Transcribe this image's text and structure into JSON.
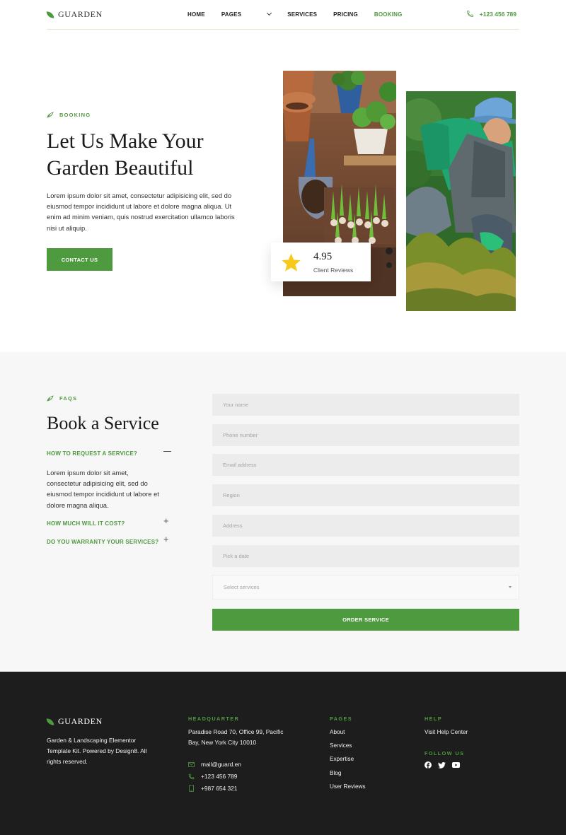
{
  "brand": {
    "name": "GUARDEN"
  },
  "nav": {
    "items": [
      {
        "label": "HOME",
        "active": false
      },
      {
        "label": "PAGES",
        "active": false,
        "has_dropdown": true
      },
      {
        "label": "SERVICES",
        "active": false
      },
      {
        "label": "PRICING",
        "active": false
      },
      {
        "label": "BOOKING",
        "active": true
      }
    ],
    "phone": "+123 456 789"
  },
  "hero": {
    "eyebrow": "BOOKING",
    "title_line1": "Let Us Make Your",
    "title_line2": "Garden Beautiful",
    "body": "Lorem ipsum dolor sit amet, consectetur adipisicing elit, sed do eiusmod tempor incididunt ut labore et dolore magna aliqua. Ut enim ad minim veniam, quis nostrud exercitation ullamco laboris nisi ut aliquip.",
    "cta_label": "CONTACT US",
    "rating": {
      "value": "4.95",
      "label": "Client Reviews",
      "icon": "star-icon"
    }
  },
  "booking": {
    "eyebrow": "FAQS",
    "title": "Book a Service",
    "faqs": [
      {
        "question": "HOW TO REQUEST A SERVICE?",
        "expanded": true,
        "answer": "Lorem ipsum dolor sit amet, consectetur adipisicing elit, sed do eiusmod tempor incididunt ut labore et dolore magna aliqua."
      },
      {
        "question": "HOW MUCH WILL IT COST?",
        "expanded": false
      },
      {
        "question": "DO YOU WARRANTY YOUR SERVICES?",
        "expanded": false
      }
    ],
    "form": {
      "name_placeholder": "Your name",
      "phone_placeholder": "Phone number",
      "email_placeholder": "Email address",
      "region_placeholder": "Region",
      "address_placeholder": "Address",
      "date_placeholder": "Pick a date",
      "service_placeholder": "Select services",
      "submit_label": "ORDER SERVICE"
    }
  },
  "footer": {
    "brand": "GUARDEN",
    "about": "Garden & Landscaping Elementor Template Kit. Powered by Design8. All rights reserved.",
    "hq_heading": "HEADQUARTER",
    "hq_address": "Paradise Road 70, Office 99, Pacific Bay,  New York City 10010",
    "email": "mail@guard.en",
    "phone1": "+123 456 789",
    "phone2": "+987 654 321",
    "pages_heading": "PAGES",
    "pages": [
      "About",
      "Services",
      "Expertise",
      "Blog",
      "User Reviews"
    ],
    "help_heading": "HELP",
    "help_link": "Visit Help Center",
    "follow_heading": "FOLLOW US",
    "social_icons": [
      "facebook-icon",
      "twitter-icon",
      "youtube-icon"
    ]
  },
  "colors": {
    "accent": "#4e9a3f",
    "footer_bg": "#1d1d1d",
    "section_bg": "#f7f7f7"
  }
}
